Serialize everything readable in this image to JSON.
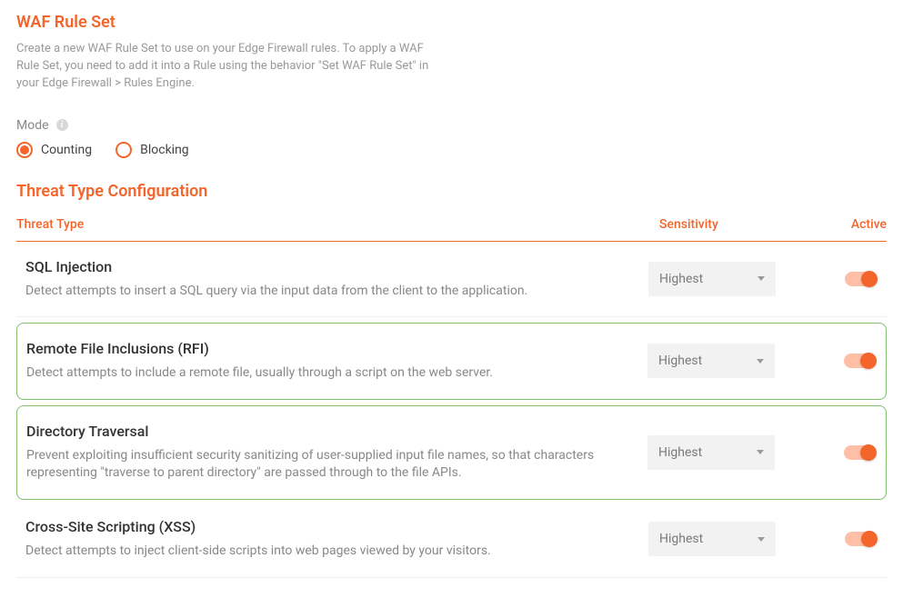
{
  "header": {
    "title": "WAF Rule Set",
    "description": "Create a new WAF Rule Set to use on your Edge Firewall rules. To apply a WAF Rule Set, you need to add it into a Rule using the behavior \"Set WAF Rule Set\" in your Edge Firewall > Rules Engine."
  },
  "mode": {
    "label": "Mode",
    "options": {
      "counting": "Counting",
      "blocking": "Blocking"
    },
    "selected": "counting"
  },
  "section": {
    "title": "Threat Type Configuration"
  },
  "columns": {
    "threat": "Threat Type",
    "sensitivity": "Sensitivity",
    "active": "Active"
  },
  "threats": [
    {
      "name": "SQL Injection",
      "desc": "Detect attempts to insert a SQL query via the input data from the client to the application.",
      "sensitivity": "Highest",
      "active": true,
      "highlight": false
    },
    {
      "name": "Remote File Inclusions (RFI)",
      "desc": "Detect attempts to include a remote file, usually through a script on the web server.",
      "sensitivity": "Highest",
      "active": true,
      "highlight": true
    },
    {
      "name": "Directory Traversal",
      "desc": "Prevent exploiting insufficient security sanitizing of user-supplied input file names, so that characters representing \"traverse to parent directory\" are passed through to the file APIs.",
      "sensitivity": "Highest",
      "active": true,
      "highlight": true
    },
    {
      "name": "Cross-Site Scripting (XSS)",
      "desc": "Detect attempts to inject client-side scripts into web pages viewed by your visitors.",
      "sensitivity": "Highest",
      "active": true,
      "highlight": false
    }
  ]
}
